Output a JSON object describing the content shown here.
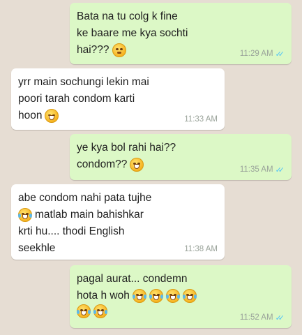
{
  "messages": [
    {
      "direction": "out",
      "lines": [
        "Bata na tu colg k fine",
        "ke baare me kya sochti",
        "hai???"
      ],
      "emoji_line_end": [
        "",
        "",
        "squint-face-emoji"
      ],
      "time": "11:29 AM",
      "status": "read"
    },
    {
      "direction": "in",
      "lines": [
        "yrr main sochungi lekin mai",
        "poori tarah condom karti",
        "hoon"
      ],
      "emoji_line_end": [
        "",
        "",
        "blush-face-emoji"
      ],
      "time": "11:33 AM"
    },
    {
      "direction": "out",
      "lines": [
        "ye kya bol rahi hai??",
        "condom??"
      ],
      "emoji_line_end": [
        "",
        "grin-face-emoji"
      ],
      "time": "11:35 AM",
      "status": "read"
    },
    {
      "direction": "in",
      "lines": [
        "abe condom nahi pata tujhe",
        "matlab main bahishkar",
        "krti hu.... thodi English",
        "seekhle"
      ],
      "emoji_line_start": [
        "",
        "tears-of-joy-emoji",
        "",
        ""
      ],
      "time": "11:38 AM"
    },
    {
      "direction": "out",
      "lines": [
        "pagal aurat... condemn",
        "hota h woh"
      ],
      "emoji_count_line2": 4,
      "emoji_count_line3": 2,
      "time": "11:52 AM",
      "status": "read"
    }
  ],
  "colors": {
    "outgoing": "#dcf8c6",
    "incoming": "#ffffff",
    "background": "#e6ddd3",
    "read_ticks": "#4fc3f7"
  }
}
